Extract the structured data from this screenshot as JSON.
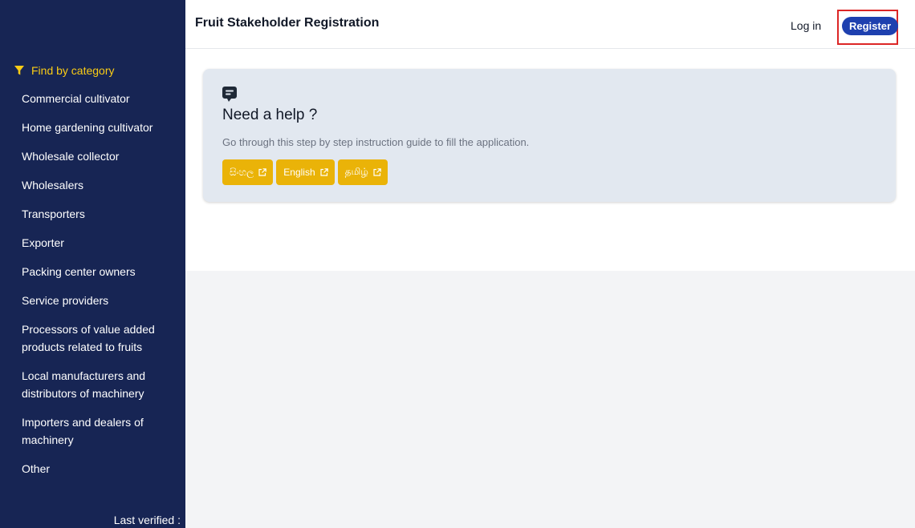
{
  "header": {
    "title": "Fruit Stakeholder Registration",
    "login_label": "Log in",
    "register_label": "Register"
  },
  "sidebar": {
    "heading": "Find by category",
    "items": [
      {
        "label": "Commercial cultivator"
      },
      {
        "label": "Home gardening cultivator"
      },
      {
        "label": "Wholesale collector"
      },
      {
        "label": "Wholesalers"
      },
      {
        "label": "Transporters"
      },
      {
        "label": "Exporter"
      },
      {
        "label": "Packing center owners"
      },
      {
        "label": "Service providers"
      },
      {
        "label": "Processors of value added products related to fruits"
      },
      {
        "label": "Local manufacturers and distributors of machinery"
      },
      {
        "label": "Importers and dealers of machinery"
      },
      {
        "label": "Other"
      }
    ],
    "footer": "Last verified :"
  },
  "help_card": {
    "title": "Need a help ?",
    "description": "Go through this step by step instruction guide to fill the application.",
    "languages": [
      {
        "label": "සිංහල"
      },
      {
        "label": "English"
      },
      {
        "label": "தமிழ்"
      }
    ]
  },
  "colors": {
    "sidebar_bg": "#172554",
    "accent_yellow": "#eab308",
    "register_blue": "#1e40af",
    "highlight_red": "#dc2626"
  }
}
